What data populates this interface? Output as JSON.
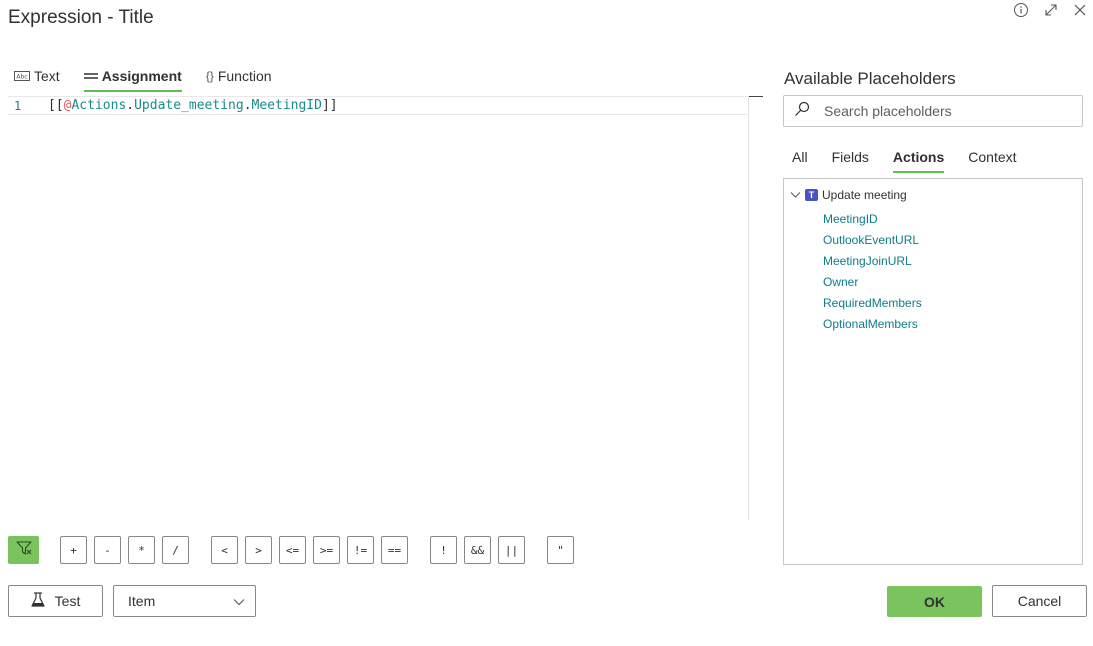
{
  "dialog": {
    "title": "Expression - Title"
  },
  "window_icons": [
    "info-icon",
    "expand-icon",
    "close-icon"
  ],
  "editor": {
    "tabs": [
      {
        "label": "Text",
        "icon": "text-icon",
        "glyph": "Abc"
      },
      {
        "label": "Assignment",
        "icon": "assignment-icon",
        "glyph": "=",
        "active": true
      },
      {
        "label": "Function",
        "icon": "function-icon",
        "glyph": "{}"
      }
    ],
    "line_number": "1",
    "code": {
      "open": "[[",
      "at": "@",
      "obj": "Actions",
      "dot1": ".",
      "action": "Update_meeting",
      "dot2": ".",
      "prop": "MeetingID",
      "close": "]]"
    }
  },
  "operators": [
    "+",
    "-",
    "*",
    "/",
    "<",
    ">",
    "<=",
    ">=",
    "!=",
    "==",
    "!",
    "&&",
    "||",
    "\""
  ],
  "bottom": {
    "test_label": "Test",
    "select_value": "Item"
  },
  "placeholders": {
    "title": "Available Placeholders",
    "search_placeholder": "Search placeholders",
    "tabs": [
      "All",
      "Fields",
      "Actions",
      "Context"
    ],
    "active_tab": "Actions",
    "tree": {
      "group": "Update meeting",
      "items": [
        "MeetingID",
        "OutlookEventURL",
        "MeetingJoinURL",
        "Owner",
        "RequiredMembers",
        "OptionalMembers"
      ]
    }
  },
  "actions": {
    "ok_label": "OK",
    "cancel_label": "Cancel"
  },
  "colors": {
    "accent": "#7ac35f",
    "underline": "#5dc04c",
    "link": "#0f7c8c",
    "teams": "#4b53bc"
  }
}
